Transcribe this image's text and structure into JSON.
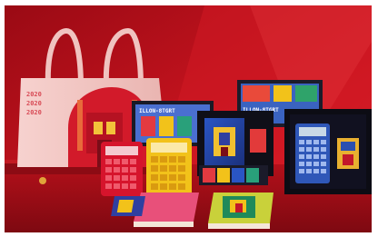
{
  "photo": {
    "kind": "product-photo",
    "subject": "red themed stationery gift set",
    "bag_print": [
      "2020",
      "2020",
      "2020"
    ],
    "box_tag_1": "ILLON-8TGRT",
    "box_tag_2": "ILLON-8TGRT",
    "palette": {
      "backdrop": "#c0121f",
      "bag": "#f2c6c3",
      "calc_red": "#d6142c",
      "calc_yellow": "#f2c21a",
      "calc_blue": "#2f57b8",
      "box_dark": "#101019"
    }
  }
}
